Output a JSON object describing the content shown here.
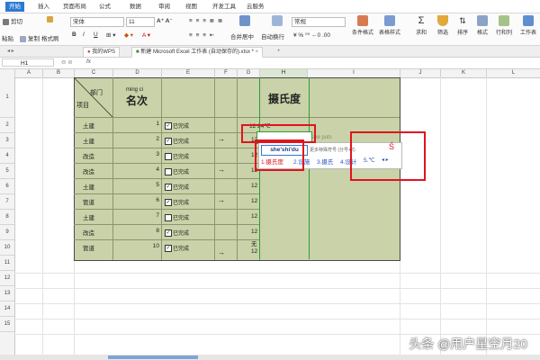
{
  "ribbon_tabs": [
    "开始",
    "插入",
    "页面布局",
    "公式",
    "数据",
    "审阅",
    "视图",
    "开发工具",
    "云服务"
  ],
  "ribbon": {
    "cut": "剪切",
    "paste": "粘贴",
    "copy": "复制",
    "format_painter": "格式刷",
    "font_name": "宋体",
    "font_size": "11",
    "bold": "B",
    "italic": "I",
    "underline": "U",
    "merge_center": "合并居中",
    "wrap_text": "自动换行",
    "number_format": "常规",
    "cond_format": "条件格式",
    "table_style": "表格样式",
    "sum": "求和",
    "filter": "筛选",
    "sort": "排序",
    "format": "格式",
    "row_col": "行和列",
    "worksheet": "工作表"
  },
  "doc_tabs": {
    "my_wps": "我的WPS",
    "file": "新建 Microsoft Excel 工作表 (自动保存的).xlsx *"
  },
  "formula_bar": {
    "name_box": "H1",
    "fx": "fx",
    "value": ""
  },
  "columns": [
    "A",
    "B",
    "C",
    "D",
    "E",
    "F",
    "G",
    "H",
    "I",
    "J",
    "K",
    "L"
  ],
  "rows": [
    "1",
    "2",
    "3",
    "4",
    "5",
    "6",
    "7",
    "8",
    "9",
    "10",
    "11",
    "12",
    "13",
    "14",
    "15"
  ],
  "table": {
    "header_dept": "部门",
    "header_item": "项目",
    "header_pinyin": "ming ci",
    "header_rank": "名次",
    "header_celsius": "摄氏度",
    "depts": [
      "土建",
      "土建",
      "改造",
      "改造",
      "土建",
      "管道",
      "土建",
      "改造",
      "管道"
    ],
    "ranks": [
      "1",
      "2",
      "3",
      "4",
      "5",
      "6",
      "7",
      "8",
      "10"
    ],
    "done_label": "已完成",
    "checked": [
      true,
      true,
      false,
      false,
      true,
      true,
      false,
      true,
      true
    ],
    "arrow": "→",
    "g_values": [
      "12",
      "12",
      "12",
      "12",
      "12",
      "12",
      "无",
      "12",
      "无",
      "12"
    ],
    "g2_text": "12 24℃",
    "g3_text": "12"
  },
  "ime": {
    "composition": "she'shi'du",
    "hint": "更多特殊符号 (分号+Z)",
    "candidates": [
      "1.摄氏度",
      "2.设施",
      "3.摄氏",
      "4.设计",
      "5.℃"
    ],
    "floating": "she puts"
  },
  "watermark": "头条 @用户星空月20",
  "colors": {
    "table_bg": "#c9d2a8",
    "accent": "#2b7ad1",
    "highlight": "#e0141e"
  }
}
